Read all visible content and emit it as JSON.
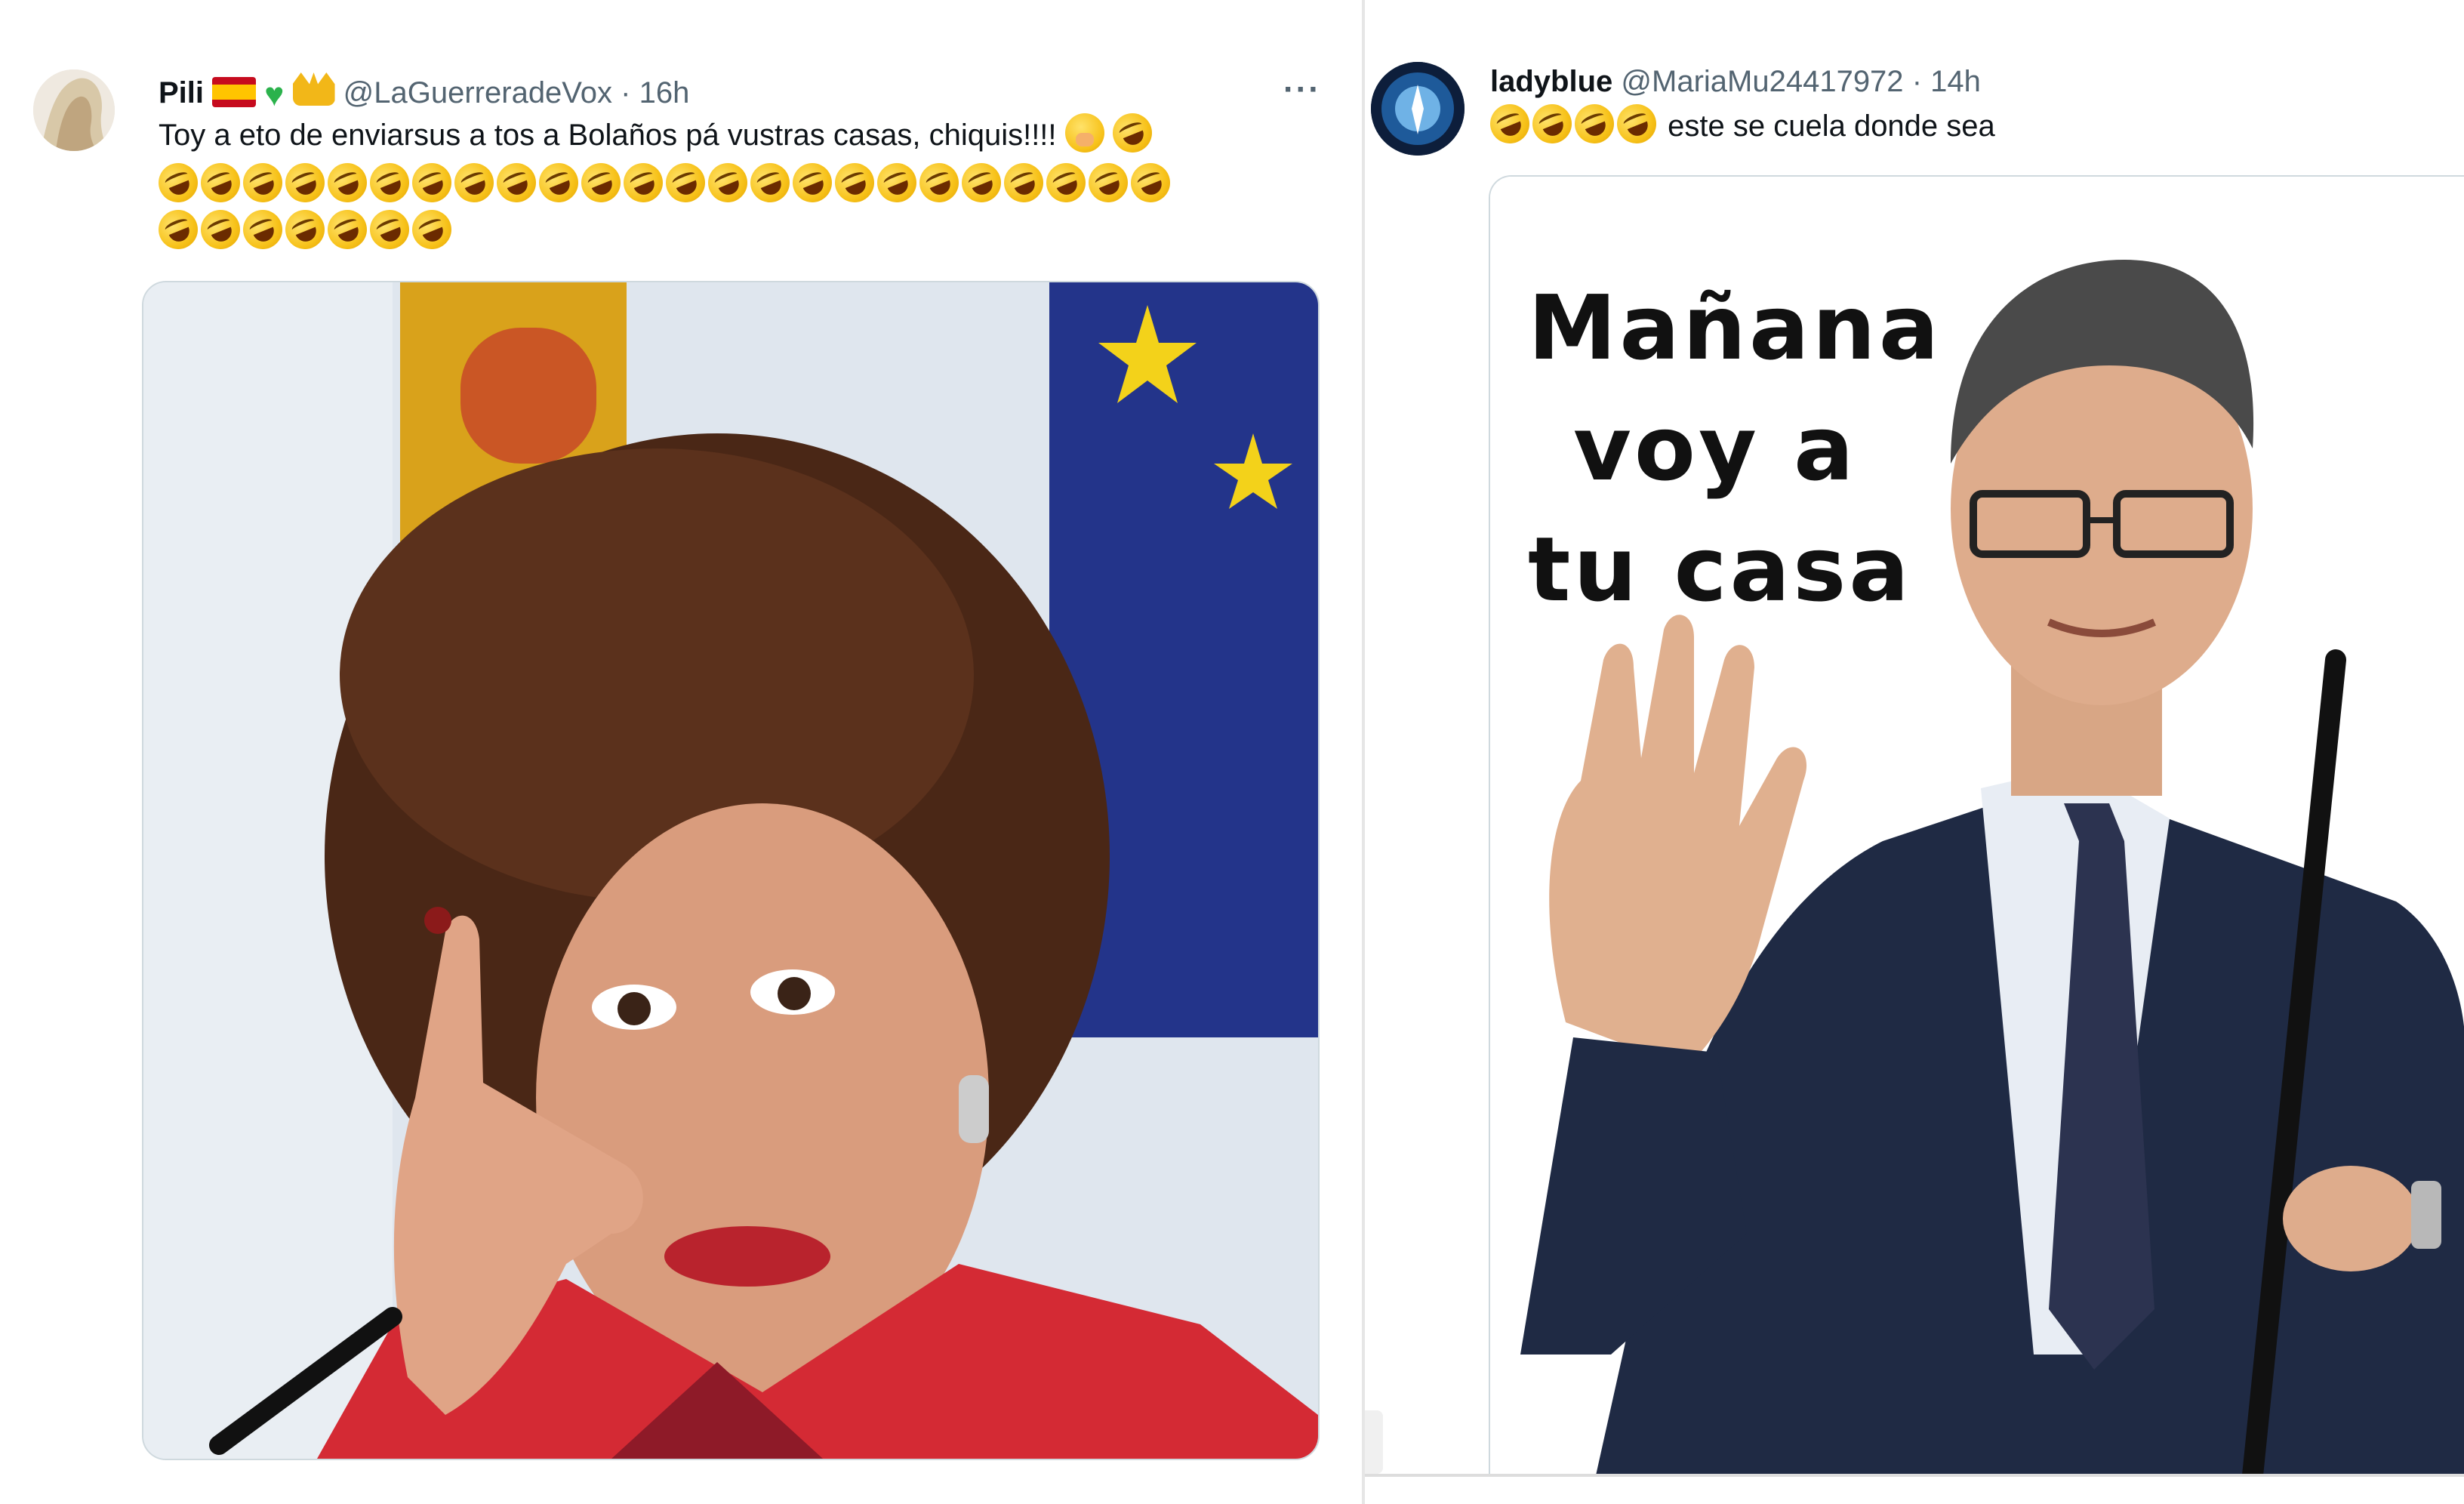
{
  "left_tweet": {
    "display_name": "Pili",
    "handle": "@LaGuerreradeVox",
    "separator": "·",
    "time": "16h",
    "more_label": "···",
    "text": "Toy a eto de enviarsus a tos a Bolaños pá vustras casas, chiquis!!!!",
    "name_emojis": [
      "flag-spain-icon",
      "green-heart-icon",
      "crown-icon"
    ],
    "trailing_emoji_count": 31,
    "media": {
      "kind": "photo",
      "description_icon": "photo-woman-red-jacket-icon"
    }
  },
  "right_tweet": {
    "display_name": "ladyblue",
    "handle": "@MariaMu24417972",
    "separator": "·",
    "time": "14h",
    "text": "este se cuela donde sea",
    "leading_emoji_count": 4,
    "media": {
      "kind": "photo",
      "meme_lines": [
        "Mañana",
        "voy a",
        "tu casa"
      ]
    }
  },
  "colors": {
    "text_primary": "#0f1419",
    "text_secondary": "#536471",
    "border": "#cfd9de",
    "jacket_red": "#d42a34",
    "suit_navy": "#1f2a44"
  }
}
